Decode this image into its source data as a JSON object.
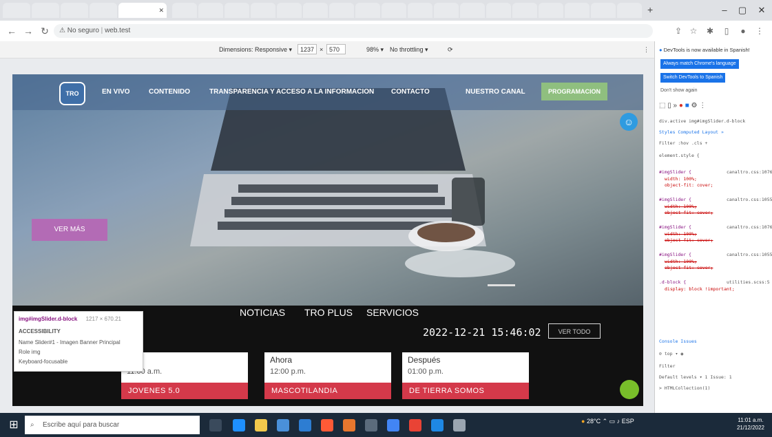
{
  "browser": {
    "tabs": [
      "",
      "",
      "",
      "",
      "",
      "",
      "",
      "",
      "",
      "",
      "",
      "",
      "",
      "",
      "",
      "",
      "",
      "",
      "",
      "",
      "",
      "",
      ""
    ],
    "window_controls": [
      "–",
      "▢",
      "✕"
    ],
    "url_prefix": "No seguro",
    "url": "web.test"
  },
  "device_toolbar": {
    "dimensions_label": "Dimensions: Responsive ▾",
    "width": "1237",
    "times": "×",
    "height": "570",
    "zoom": "98% ▾",
    "throttling": "No throttling ▾"
  },
  "site": {
    "logo_text": "TRO",
    "nav": [
      "EN VIVO",
      "CONTENIDO",
      "TRANSPARENCIA Y ACCESO A LA INFORMACION",
      "CONTACTO",
      "NUESTRO CANAL"
    ],
    "programacion_label": "PROGRAMACION",
    "ver_mas_label": "VER MÁS",
    "sections": [
      "NOTICIAS",
      "TRO PLUS",
      "SERVICIOS"
    ],
    "datetime": "2022-12-21 15:46:02",
    "ver_todo_label": "VER TODO",
    "schedule": [
      {
        "when": "es",
        "time": "11:00 a.m.",
        "show": "JOVENES 5.0"
      },
      {
        "when": "Ahora",
        "time": "12:00 p.m.",
        "show": "MASCOTILANDIA"
      },
      {
        "when": "Después",
        "time": "01:00 p.m.",
        "show": "DE TIERRA SOMOS"
      }
    ]
  },
  "inspector_tooltip": {
    "selector": "img#imgSlider.d-block",
    "size": "1217 × 670.21",
    "section": "ACCESSIBILITY",
    "name_row": "Name  Slider#1 - Imagen Banner Principal",
    "role_row": "Role                                      img",
    "focus_row": "Keyboard-focusable"
  },
  "devtools": {
    "notice": "DevTools is now available in Spanish!",
    "btn_match": "Always match Chrome's language",
    "btn_switch": "Switch DevTools to Spanish",
    "dont_show": "Don't show again",
    "breadcrumb": "div.active  img#imgSlider.d-block",
    "panel_tabs": "Styles   Computed   Layout   »",
    "filter": "Filter               :hov  .cls  +",
    "element_style": "element.style {",
    "rules": [
      {
        "selector": "#imgSlider {",
        "source": "canaltro.css:1076",
        "props": [
          "width: 100%;",
          "object-fit: cover;"
        ]
      },
      {
        "selector": "#imgSlider {",
        "source": "canaltro.css:1055",
        "props": [
          "width: 100%;",
          "object-fit: cover;"
        ]
      },
      {
        "selector": "#imgSlider {",
        "source": "canaltro.css:1076",
        "props": [
          "width: 100%;",
          "object-fit: cover;"
        ]
      },
      {
        "selector": "#imgSlider {",
        "source": "canaltro.css:1055",
        "props": [
          "width: 100%;",
          "object-fit: cover;"
        ]
      },
      {
        "selector": ".d-block {",
        "source": "utilities.scss:5",
        "props": [
          "display: block !important;"
        ]
      }
    ],
    "console_tabs": "Console   Issues",
    "console_top": "top ▾",
    "console_filter": "Filter",
    "default_levels": "Default levels ▾    1 Issue: 1",
    "console_input": "> HTMLCollection(1)"
  },
  "taskbar": {
    "search_placeholder": "Escribe aquí para buscar",
    "weather": "28°C",
    "lang": "ESP",
    "time": "11:01 a.m.",
    "date": "21/12/2022"
  },
  "colors": {
    "programacion": "#8fbf7f",
    "ver_mas": "#b36bb5",
    "schedule_show": "#d4394a",
    "devtools_button": "#1a73e8"
  }
}
